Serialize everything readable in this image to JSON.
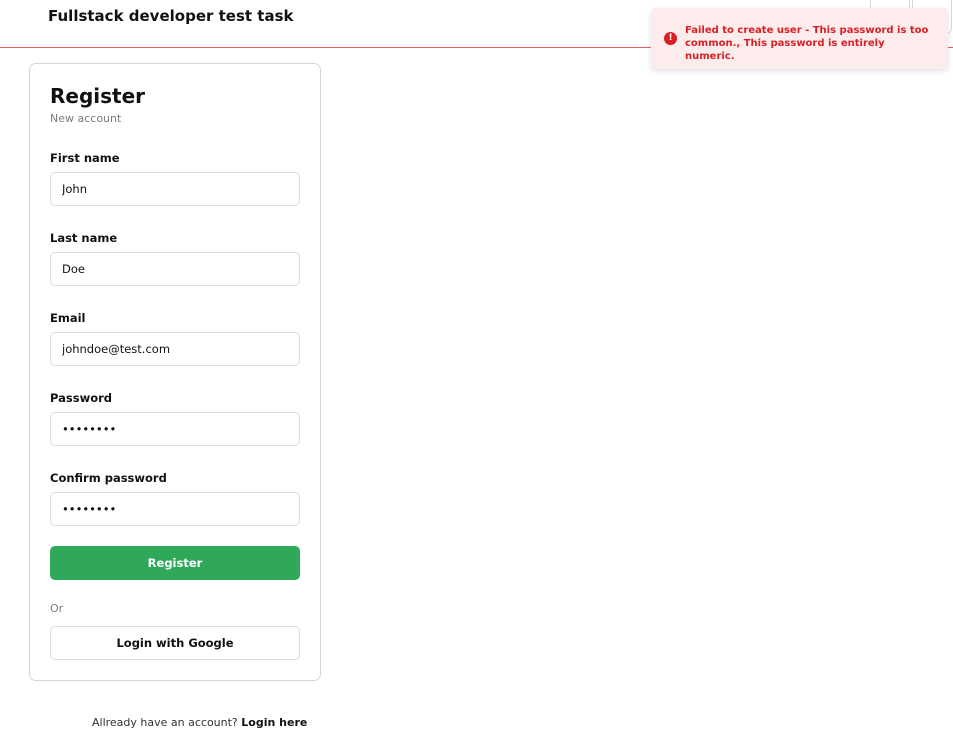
{
  "header": {
    "title": "Fullstack developer test task"
  },
  "card": {
    "title": "Register",
    "subtitle": "New account"
  },
  "form": {
    "first_name": {
      "label": "First name",
      "value": "John"
    },
    "last_name": {
      "label": "Last name",
      "value": "Doe"
    },
    "email": {
      "label": "Email",
      "value": "johndoe@test.com"
    },
    "password": {
      "label": "Password",
      "value": "••••••••"
    },
    "confirm_password": {
      "label": "Confirm password",
      "value": "••••••••"
    }
  },
  "buttons": {
    "register": "Register",
    "or": "Or",
    "google": "Login with Google"
  },
  "footer": {
    "prompt": "Allready have an account?",
    "link": "Login here"
  },
  "toast": {
    "icon": "error-icon",
    "message": "Failed to create user - This password is too common., This password is entirely numeric."
  },
  "colors": {
    "accent": "#2fa85a",
    "error": "#d91f26",
    "toast_bg": "#fdecec",
    "header_border": "#e06060"
  }
}
